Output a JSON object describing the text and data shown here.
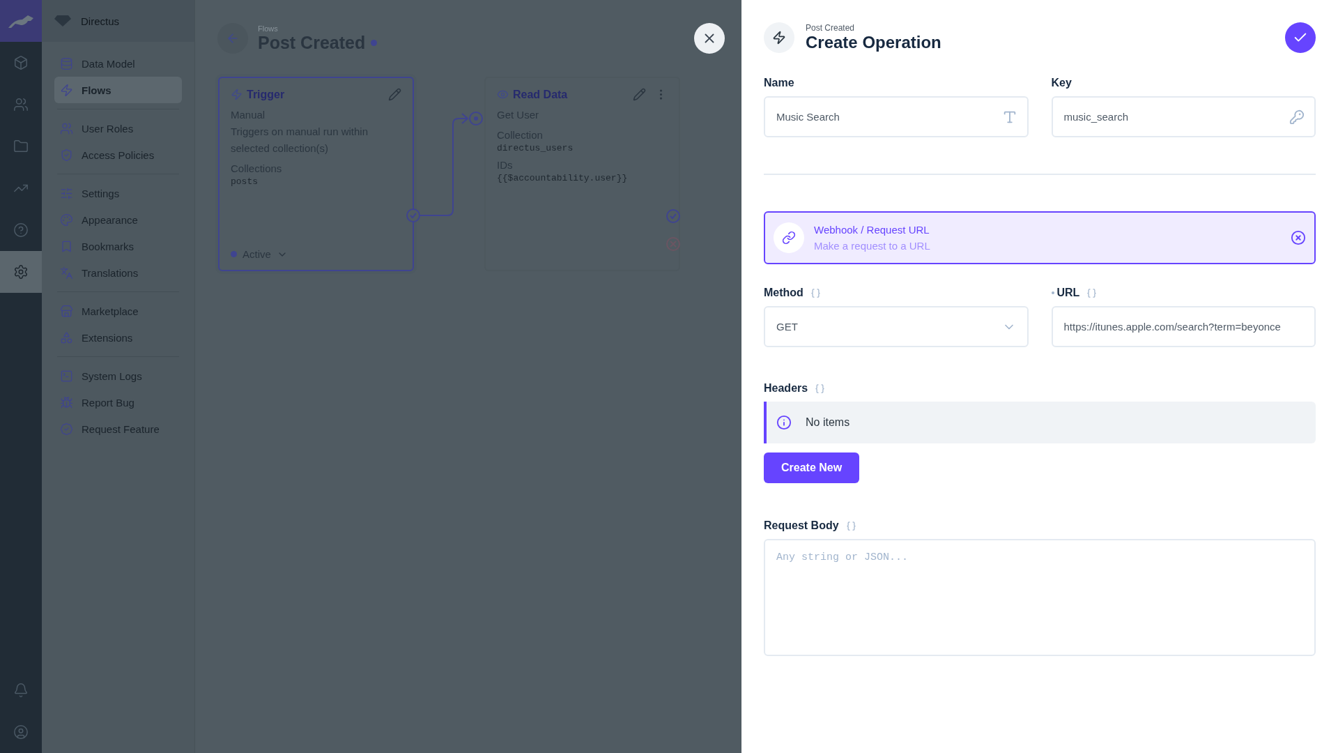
{
  "module_bar": {
    "top": [
      {
        "selected": false
      },
      {
        "selected": false
      },
      {
        "selected": false
      },
      {
        "selected": false
      },
      {
        "selected": false
      },
      {
        "selected": true
      }
    ],
    "bottom": [
      {
        "selected": false
      },
      {
        "selected": false
      }
    ]
  },
  "nav": {
    "project": "Directus",
    "groups": [
      [
        {
          "label": "Data Model",
          "selected": false
        },
        {
          "label": "Flows",
          "selected": true
        }
      ],
      [
        {
          "label": "User Roles",
          "selected": false
        },
        {
          "label": "Access Policies",
          "selected": false
        }
      ],
      [
        {
          "label": "Settings",
          "selected": false
        },
        {
          "label": "Appearance",
          "selected": false
        },
        {
          "label": "Bookmarks",
          "selected": false
        },
        {
          "label": "Translations",
          "selected": false
        }
      ],
      [
        {
          "label": "Marketplace",
          "selected": false
        },
        {
          "label": "Extensions",
          "selected": false
        }
      ],
      [
        {
          "label": "System Logs",
          "selected": false
        },
        {
          "label": "Report Bug",
          "selected": false
        },
        {
          "label": "Request Feature",
          "selected": false
        }
      ]
    ]
  },
  "header": {
    "breadcrumb": "Flows",
    "title": "Post Created"
  },
  "cards": [
    {
      "kind": "trigger",
      "title": "Trigger",
      "selected": true,
      "subtitle": "Manual",
      "description": "Triggers on manual run within selected collection(s)",
      "fields": [
        {
          "label": "Collections",
          "value": "posts"
        }
      ],
      "status": "Active"
    },
    {
      "kind": "operation",
      "title": "Read Data",
      "selected": false,
      "subtitle": "Get User",
      "fields": [
        {
          "label": "Collection",
          "value": "directus_users"
        },
        {
          "label": "IDs",
          "value": "{{$accountability.user}}"
        }
      ]
    }
  ],
  "drawer": {
    "breadcrumb": "Post Created",
    "title": "Create Operation",
    "name": {
      "label": "Name",
      "value": "Music Search"
    },
    "key": {
      "label": "Key",
      "value": "music_search"
    },
    "operation": {
      "title": "Webhook / Request URL",
      "description": "Make a request to a URL"
    },
    "method": {
      "label": "Method",
      "value": "GET"
    },
    "url": {
      "label": "URL",
      "value": "https://itunes.apple.com/search?term=beyonce",
      "required": true
    },
    "headers": {
      "label": "Headers",
      "empty": "No items",
      "button": "Create New"
    },
    "body": {
      "label": "Request Body",
      "placeholder": "Any string or JSON..."
    }
  }
}
